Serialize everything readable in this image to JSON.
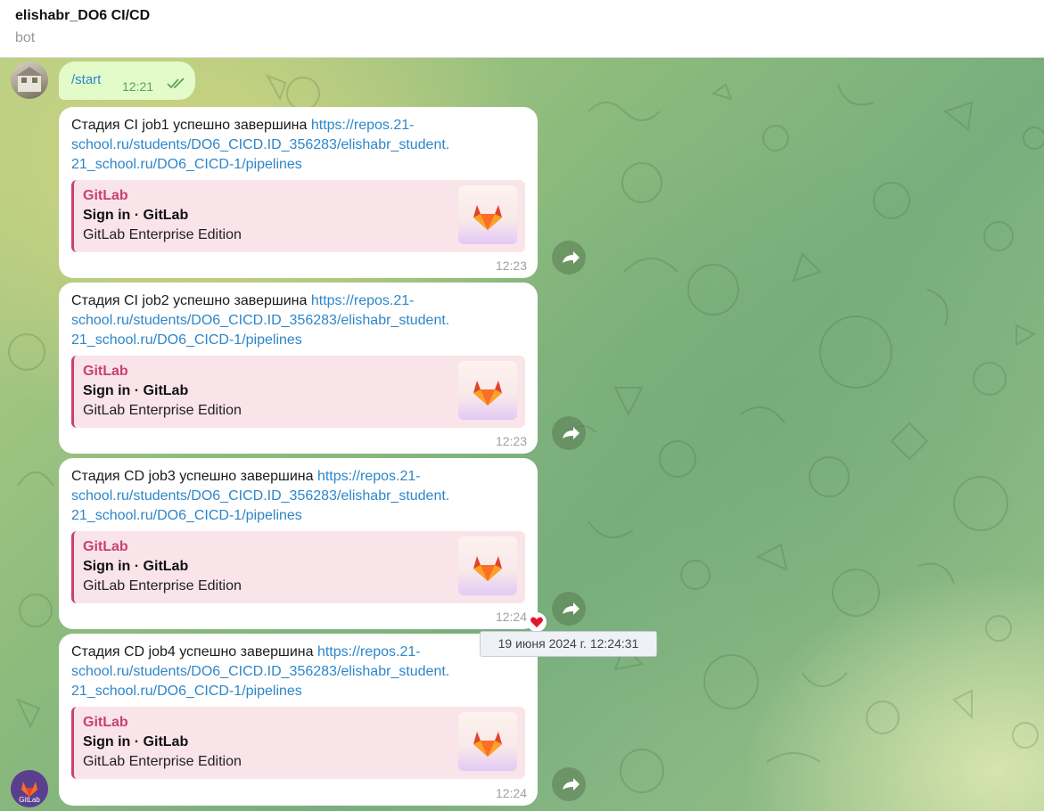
{
  "header": {
    "title": "elishabr_DO6 CI/CD",
    "subtitle": "bot"
  },
  "outgoing": {
    "text": "/start",
    "time": "12:21",
    "status_icon": "double-check-icon"
  },
  "messages": [
    {
      "text": "Стадия CI job1 успешно завершина",
      "link": "https://repos.21-school.ru/students/DO6_CICD.ID_356283/elishabr_student.21_school.ru/DO6_CICD-1/pipelines",
      "link_line1": "https://repos.21-",
      "link_line2": "school.ru/students/DO6_CICD.ID_356283/elishabr_student.",
      "link_line3": "21_school.ru/DO6_CICD-1/pipelines",
      "preview": {
        "site": "GitLab",
        "title": "Sign in · GitLab",
        "description": "GitLab Enterprise Edition"
      },
      "time": "12:23"
    },
    {
      "text": "Стадия CI job2 успешно завершина",
      "link": "https://repos.21-school.ru/students/DO6_CICD.ID_356283/elishabr_student.21_school.ru/DO6_CICD-1/pipelines",
      "link_line1": "https://repos.21-",
      "link_line2": "school.ru/students/DO6_CICD.ID_356283/elishabr_student.",
      "link_line3": "21_school.ru/DO6_CICD-1/pipelines",
      "preview": {
        "site": "GitLab",
        "title": "Sign in · GitLab",
        "description": "GitLab Enterprise Edition"
      },
      "time": "12:23"
    },
    {
      "text": "Стадия CD job3 успешно завершина",
      "link": "https://repos.21-school.ru/students/DO6_CICD.ID_356283/elishabr_student.21_school.ru/DO6_CICD-1/pipelines",
      "link_line1": "https://repos.21-",
      "link_line2": "school.ru/students/DO6_CICD.ID_356283/elishabr_student.",
      "link_line3": "21_school.ru/DO6_CICD-1/pipelines",
      "preview": {
        "site": "GitLab",
        "title": "Sign in · GitLab",
        "description": "GitLab Enterprise Edition"
      },
      "time": "12:24"
    },
    {
      "text": "Стадия CD job4 успешно завершина",
      "link": "https://repos.21-school.ru/students/DO6_CICD.ID_356283/elishabr_student.21_school.ru/DO6_CICD-1/pipelines",
      "link_line1": "https://repos.21-",
      "link_line2": "school.ru/students/DO6_CICD.ID_356283/elishabr_student.",
      "link_line3": "21_school.ru/DO6_CICD-1/pipelines",
      "preview": {
        "site": "GitLab",
        "title": "Sign in · GitLab",
        "description": "GitLab Enterprise Edition"
      },
      "time": "12:24"
    }
  ],
  "tooltip": {
    "text": "19 июня 2024 г. 12:24:31"
  },
  "bot_avatar": {
    "label": "GitLab"
  },
  "colors": {
    "link": "#2d86c9",
    "preview_accent": "#c9416f",
    "preview_bg": "#f9e4ea",
    "outgoing_bg": "#e2fbc9"
  },
  "icons": {
    "forward": "forward-arrow-icon",
    "reaction": "heart-icon",
    "preview_logo": "gitlab-logo-icon"
  }
}
